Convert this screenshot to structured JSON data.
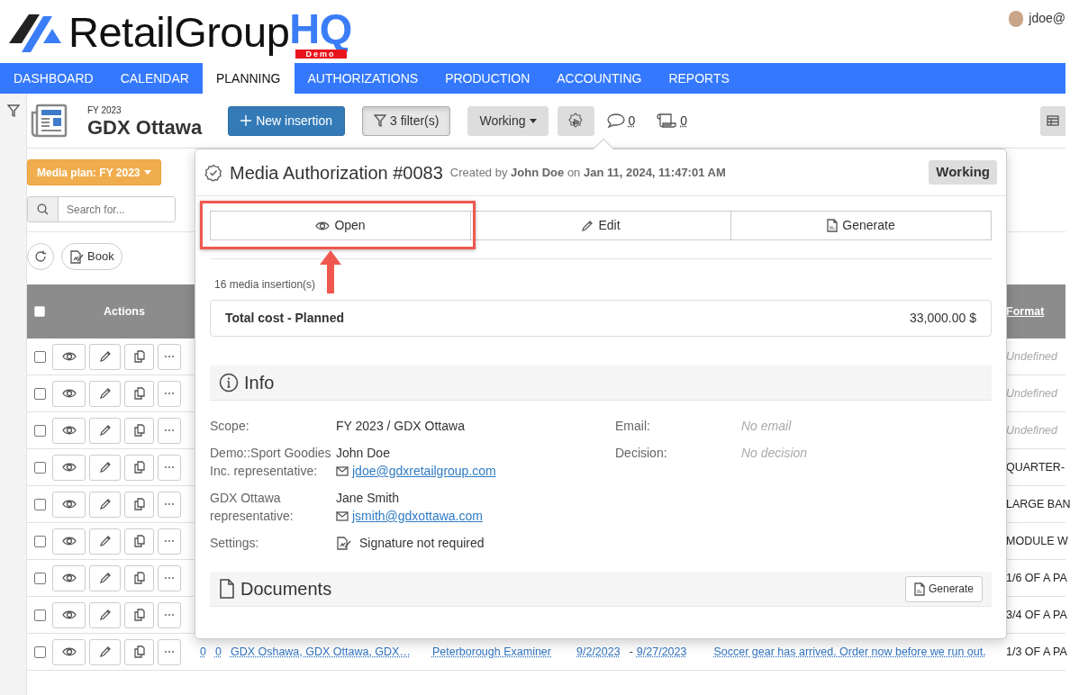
{
  "header": {
    "logo": {
      "name": "RetailGroup",
      "accent": "HQ",
      "badge": "Demo"
    },
    "user": "jdoe@"
  },
  "nav": [
    {
      "label": "DASHBOARD",
      "selected": false
    },
    {
      "label": "CALENDAR",
      "selected": false
    },
    {
      "label": "PLANNING",
      "selected": true
    },
    {
      "label": "AUTHORIZATIONS",
      "selected": false
    },
    {
      "label": "PRODUCTION",
      "selected": false
    },
    {
      "label": "ACCOUNTING",
      "selected": false
    },
    {
      "label": "REPORTS",
      "selected": false
    }
  ],
  "page": {
    "subtitle": "FY 2023",
    "title": "GDX Ottawa",
    "new_button": "New insertion",
    "filter_button": "3 filter(s)",
    "status_button": "Working",
    "comments": "0",
    "scrolls": "0"
  },
  "filters": {
    "media_plan": "Media plan: FY 2023",
    "search_placeholder": "Search for...",
    "book": "Book"
  },
  "table": {
    "header_checked": false,
    "actions": "Actions",
    "format": "Format",
    "rows": [
      {
        "checked": false,
        "format": "Undefined",
        "defined": false
      },
      {
        "checked": false,
        "format": "Undefined",
        "defined": false
      },
      {
        "checked": false,
        "format": "Undefined",
        "defined": false
      },
      {
        "checked": false,
        "format": "QUARTER-",
        "defined": true
      },
      {
        "checked": false,
        "format": "LARGE BAN",
        "defined": true
      },
      {
        "checked": false,
        "format": "MODULE W",
        "defined": true
      },
      {
        "checked": false,
        "format": "1/6 OF A PA",
        "defined": true
      },
      {
        "checked": false,
        "format": "3/4 OF A PA",
        "defined": true
      },
      {
        "checked": false,
        "format": "1/3 OF A PA",
        "defined": true,
        "cells": [
          "0",
          "0",
          "GDX Oshawa, GDX Ottawa, GDX…",
          "Peterborough Examiner",
          "9/2/2023",
          "-",
          "9/27/2023",
          "Soccer gear has arrived. Order now before we run out."
        ]
      }
    ]
  },
  "popover": {
    "title": "Media Authorization #0083",
    "meta": "Created by **John Doe** on **Jan 11, 2024, 11:47:01 AM**",
    "status": "Working",
    "buttons": [
      {
        "kind": "open",
        "label": "Open"
      },
      {
        "kind": "edit",
        "label": "Edit"
      },
      {
        "kind": "generate",
        "label": "Generate"
      }
    ],
    "count": "16 media insertion(s)",
    "total_label": "Total cost - Planned",
    "total_value": "33,000.00 $",
    "info_title": "Info",
    "info_left": [
      {
        "label": "Scope:",
        "lines": [
          {
            "kind": "text",
            "text": "FY 2023 / GDX Ottawa"
          }
        ]
      },
      {
        "label": "Demo::Sport Goodies Inc. representative:",
        "lines": [
          {
            "kind": "text",
            "text": "John Doe"
          },
          {
            "kind": "email",
            "text": "jdoe@gdxretailgroup.com"
          }
        ]
      },
      {
        "label": "GDX Ottawa representative:",
        "lines": [
          {
            "kind": "text",
            "text": "Jane Smith"
          },
          {
            "kind": "email",
            "text": "jsmith@gdxottawa.com"
          }
        ]
      },
      {
        "label": "Settings:",
        "lines": [
          {
            "kind": "signature",
            "text": "Signature not required"
          }
        ]
      }
    ],
    "info_right": [
      {
        "label": "Email:",
        "value": "No email"
      },
      {
        "label": "Decision:",
        "value": "No decision"
      }
    ],
    "documents_title": "Documents",
    "documents_button": "Generate"
  }
}
